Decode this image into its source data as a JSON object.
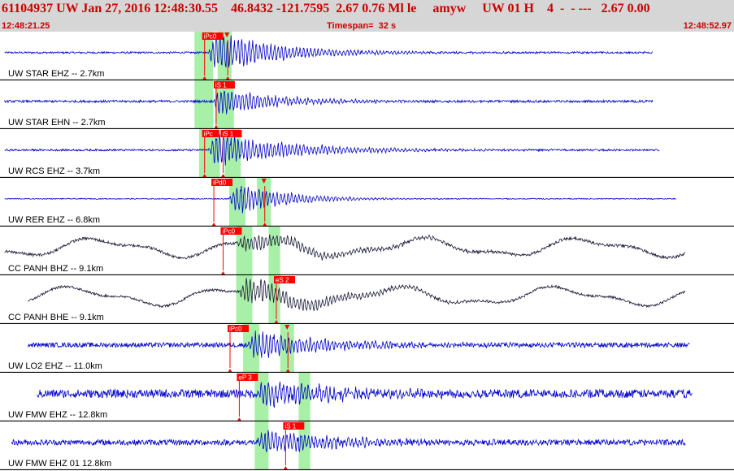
{
  "header": {
    "title": "61104937 UW Jan 27, 2016 12:48:30.55    46.8432 -121.7595  2.67 0.76 Ml le     amyw     UW 01 H    4  -  - ---   2.67 0.00",
    "start_time": "12:48:21.25",
    "timespan": "Timespan=  32 s",
    "end_time": "12:48:52.97"
  },
  "colors": {
    "header_bg": "#d6d6d6",
    "header_text": "#cc0000",
    "trace_blue": "#0000cc",
    "trace_dark": "#1a1a3a",
    "pick_red": "#ff0000",
    "window_green": "#a8f0a8"
  },
  "panels": [
    {
      "label": "UW STAR EHZ -- 2.7km",
      "color": "blue",
      "type": "quake",
      "picks": [
        {
          "text": "iPc0",
          "t": 8.8
        },
        {
          "text": "",
          "t": 9.8
        }
      ],
      "onset": 9.0,
      "amp": 0.9,
      "noise": 0.04,
      "decay": 2.8,
      "end": 28.2,
      "start": 0.2,
      "windows": [
        [
          8.4,
          9.2
        ],
        [
          9.4,
          10.0
        ]
      ]
    },
    {
      "label": "UW STAR EHN -- 2.7km",
      "color": "blue",
      "type": "quake",
      "picks": [
        {
          "text": "iS 1",
          "t": 9.3
        }
      ],
      "onset": 9.2,
      "amp": 0.6,
      "noise": 0.05,
      "decay": 2.5,
      "end": 28.2,
      "start": 0.2,
      "windows": [
        [
          8.4,
          9.2
        ],
        [
          9.3,
          10.1
        ]
      ]
    },
    {
      "label": "UW RCS EHZ -- 3.7km",
      "color": "blue",
      "type": "quake",
      "picks": [
        {
          "text": "iPc",
          "t": 8.8
        },
        {
          "text": "iS 1",
          "t": 9.6
        }
      ],
      "onset": 9.0,
      "amp": 0.7,
      "noise": 0.04,
      "decay": 3.5,
      "end": 28.5,
      "start": 0.2,
      "windows": [
        [
          8.6,
          9.5
        ],
        [
          9.7,
          10.4
        ]
      ]
    },
    {
      "label": "UW RER EHZ -- 6.8km",
      "color": "blue",
      "type": "quake",
      "picks": [
        {
          "text": "iPd0",
          "t": 9.2
        },
        {
          "text": "",
          "t": 11.4
        }
      ],
      "onset": 9.9,
      "amp": 0.7,
      "noise": 0.02,
      "decay": 2.2,
      "end": 29.2,
      "start": 0.2,
      "windows": [
        [
          9.9,
          10.6
        ],
        [
          11.1,
          11.7
        ]
      ]
    },
    {
      "label": "CC PANH BHZ -- 9.1km",
      "color": "dark",
      "type": "wave",
      "picks": [
        {
          "text": "iPc0",
          "t": 9.6
        }
      ],
      "onset": 10.2,
      "amp": 0.35,
      "noise": 0.06,
      "decay": 4.0,
      "end": 29.6,
      "start": 0.2,
      "windows": [
        [
          10.2,
          10.9
        ],
        [
          11.6,
          12.1
        ]
      ]
    },
    {
      "label": "CC PANH BHE -- 9.1km",
      "color": "dark",
      "type": "wave",
      "picks": [
        {
          "text": "eS 2",
          "t": 11.9
        }
      ],
      "onset": 10.3,
      "amp": 0.55,
      "noise": 0.05,
      "decay": 3.5,
      "end": 29.6,
      "start": 1.2,
      "windows": [
        [
          10.2,
          10.9
        ],
        [
          11.6,
          12.1
        ]
      ]
    },
    {
      "label": "UW LO2 EHZ -- 11.0km",
      "color": "blue",
      "type": "quake",
      "picks": [
        {
          "text": "iPc0",
          "t": 9.9
        },
        {
          "text": "",
          "t": 12.4
        }
      ],
      "onset": 10.7,
      "amp": 0.6,
      "noise": 0.1,
      "decay": 3.2,
      "end": 29.8,
      "start": 1.2,
      "windows": [
        [
          10.5,
          11.2
        ],
        [
          12.1,
          12.7
        ]
      ]
    },
    {
      "label": "UW FMW EHZ -- 12.8km",
      "color": "blue",
      "type": "quake",
      "picks": [
        {
          "text": "eP 3",
          "t": 10.3
        }
      ],
      "onset": 11.1,
      "amp": 0.65,
      "noise": 0.18,
      "decay": 3.0,
      "end": 29.9,
      "start": 1.6,
      "windows": [
        [
          11.0,
          11.6
        ],
        [
          12.9,
          13.4
        ]
      ]
    },
    {
      "label": "UW FMW EHZ 01 12.8km",
      "color": "blue",
      "type": "quake",
      "picks": [
        {
          "text": "iS 1",
          "t": 12.3
        }
      ],
      "onset": 11.1,
      "amp": 0.6,
      "noise": 0.12,
      "decay": 3.0,
      "end": 29.6,
      "start": 0.5,
      "windows": [
        [
          11.0,
          11.6
        ],
        [
          12.9,
          13.4
        ]
      ]
    }
  ]
}
